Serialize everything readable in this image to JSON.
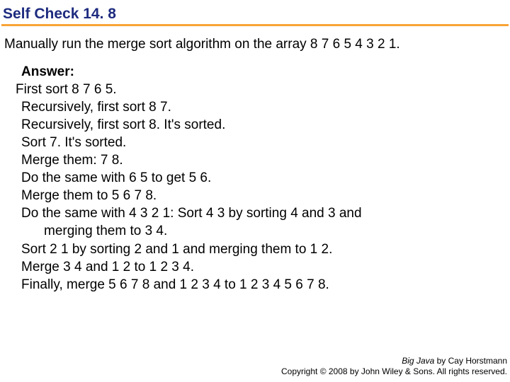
{
  "title": "Self Check 14. 8",
  "question": "Manually run the merge sort algorithm on the array 8 7 6 5 4 3 2 1.",
  "answer": {
    "label": "Answer:",
    "lines": [
      "First sort 8 7 6 5.",
      "Recursively, first sort 8 7.",
      "Recursively, first sort 8. It's sorted.",
      "Sort 7. It's sorted.",
      "Merge them: 7 8.",
      "Do the same with 6 5 to get 5 6.",
      "Merge them to 5 6 7 8.",
      "Do the same with 4 3 2 1: Sort 4 3 by sorting 4 and 3 and",
      "merging them to 3 4.",
      "Sort 2 1 by sorting 2 and 1 and merging them to 1 2.",
      "Merge 3 4 and 1 2 to 1 2 3 4.",
      "Finally, merge 5 6 7 8 and 1 2 3 4 to 1 2 3 4 5 6 7 8."
    ]
  },
  "footer": {
    "line1_italic": "Big Java",
    "line1_rest": " by Cay Horstmann",
    "line2": "Copyright © 2008 by John Wiley & Sons. All rights reserved."
  }
}
